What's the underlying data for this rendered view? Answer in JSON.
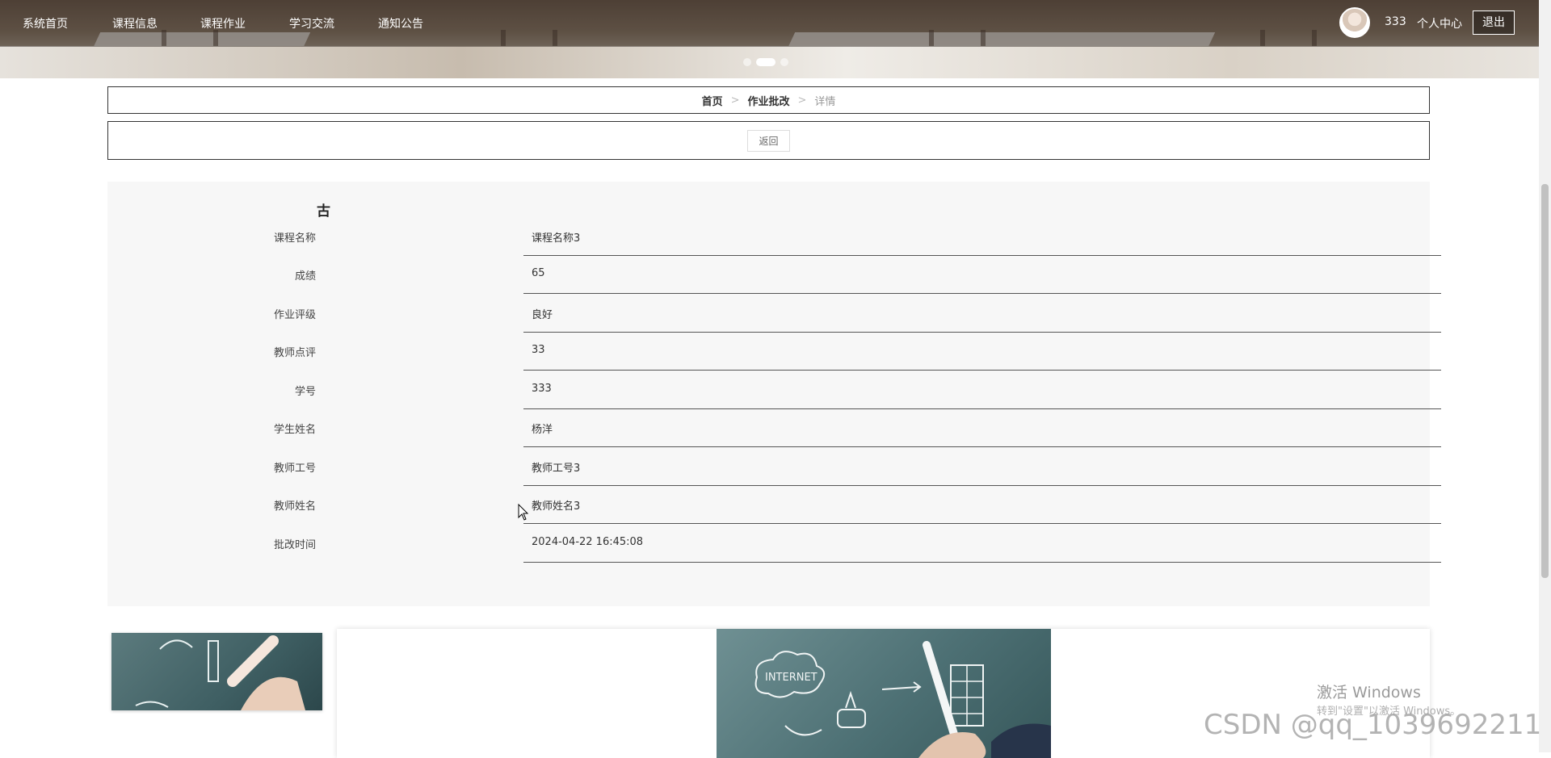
{
  "nav": {
    "items": [
      {
        "label": "系统首页"
      },
      {
        "label": "课程信息"
      },
      {
        "label": "课程作业"
      },
      {
        "label": "学习交流"
      },
      {
        "label": "通知公告"
      }
    ],
    "username": "333",
    "user_center": "个人中心",
    "logout": "退出"
  },
  "carousel": {
    "active_index": 1,
    "count": 3
  },
  "breadcrumb": {
    "home": "首页",
    "parent": "作业批改",
    "current": "详情",
    "separator": ">"
  },
  "back_label": "返回",
  "detail": {
    "title": "古",
    "fields": [
      {
        "label": "课程名称",
        "value": "课程名称3"
      },
      {
        "label": "成绩",
        "value": "65"
      },
      {
        "label": "作业评级",
        "value": "良好"
      },
      {
        "label": "教师点评",
        "value": "33"
      },
      {
        "label": "学号",
        "value": "333"
      },
      {
        "label": "学生姓名",
        "value": "杨洋"
      },
      {
        "label": "教师工号",
        "value": "教师工号3"
      },
      {
        "label": "教师姓名",
        "value": "教师姓名3"
      },
      {
        "label": "批改时间",
        "value": "2024-04-22 16:45:08"
      }
    ]
  },
  "overlay": {
    "activation_title": "激活 Windows",
    "activation_hint": "转到\"设置\"以激活 Windows。",
    "csdn": "CSDN @qq_1039692211"
  },
  "icons": {
    "avatar": "user-avatar",
    "cursor": "mouse-pointer-icon"
  },
  "colors": {
    "nav_text": "#ffffff",
    "detail_bg": "#f7f7f7",
    "border": "#333333"
  }
}
